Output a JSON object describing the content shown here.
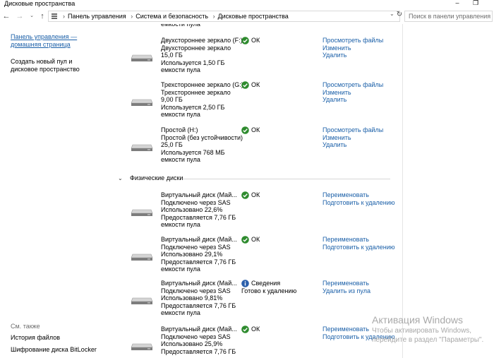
{
  "window": {
    "title": "Дисковые пространства",
    "minimize_glyph": "–",
    "restore_glyph": "❐"
  },
  "address": {
    "crumbs": [
      "Панель управления",
      "Система и безопасность",
      "Дисковые пространства"
    ],
    "search_placeholder": "Поиск в панели управления"
  },
  "left_pane": {
    "home_link": [
      "Панель управления —",
      "домашняя страница"
    ],
    "create_pool": [
      "Создать новый пул и",
      "дисковое пространство"
    ],
    "see_also": "См. также",
    "links": [
      "История файлов",
      "Шифрование диска BitLocker"
    ]
  },
  "spaces": [
    {
      "lines": [
        "Двухстороннее зеркало (F:)",
        "Двухстороннее зеркало",
        "15,0 ГБ",
        "Используется 1,50 ГБ",
        "емкости пула"
      ],
      "status": "ОК",
      "actions": [
        "Просмотреть файлы",
        "Изменить",
        "Удалить"
      ]
    },
    {
      "lines": [
        "Трехстороннее зеркало (G:)",
        "Трехстороннее зеркало",
        "9,00 ГБ",
        "Используется 2,50 ГБ",
        "емкости пула"
      ],
      "status": "ОК",
      "actions": [
        "Просмотреть файлы",
        "Изменить",
        "Удалить"
      ]
    },
    {
      "lines": [
        "Простой (H:)",
        "Простой (без устойчивости)",
        "25,0 ГБ",
        "Используется 768 МБ",
        "емкости пула"
      ],
      "status": "ОК",
      "actions": [
        "Просмотреть файлы",
        "Изменить",
        "Удалить"
      ]
    }
  ],
  "physical_section": "Физические диски",
  "physical": [
    {
      "lines": [
        "Виртуальный диск (Май...",
        "Подключено через SAS",
        "Использовано 22,6%",
        "Предоставляется 7,76 ГБ",
        "емкости пула"
      ],
      "status": "ОК",
      "status_sub": "",
      "actions": [
        "Переименовать",
        "Подготовить к удалению"
      ]
    },
    {
      "lines": [
        "Виртуальный диск (Май...",
        "Подключено через SAS",
        "Использовано 29,1%",
        "Предоставляется 7,76 ГБ",
        "емкости пула"
      ],
      "status": "ОК",
      "status_sub": "",
      "actions": [
        "Переименовать",
        "Подготовить к удалению"
      ]
    },
    {
      "lines": [
        "Виртуальный диск (Май...",
        "Подключено через SAS",
        "Использовано 9,81%",
        "Предоставляется 7,76 ГБ",
        "емкости пула"
      ],
      "status": "Сведения",
      "status_sub": "Готово к удалению",
      "actions": [
        "Переименовать",
        "Удалить из пула"
      ]
    },
    {
      "lines": [
        "Виртуальный диск (Май...",
        "Подключено через SAS",
        "Использовано 25,9%",
        "Предоставляется 7,76 ГБ"
      ],
      "status": "ОК",
      "status_sub": "",
      "actions": [
        "Переименовать",
        "Подготовить к удалению"
      ]
    }
  ],
  "watermark": {
    "line1": "Активация Windows",
    "line2": "Чтобы активировать Windows,",
    "line3": "перейдите в раздел \"Параметры\"."
  },
  "colors": {
    "link": "#1a5fa8",
    "ok_green": "#2e8b2e",
    "info_blue": "#2b5fab"
  }
}
